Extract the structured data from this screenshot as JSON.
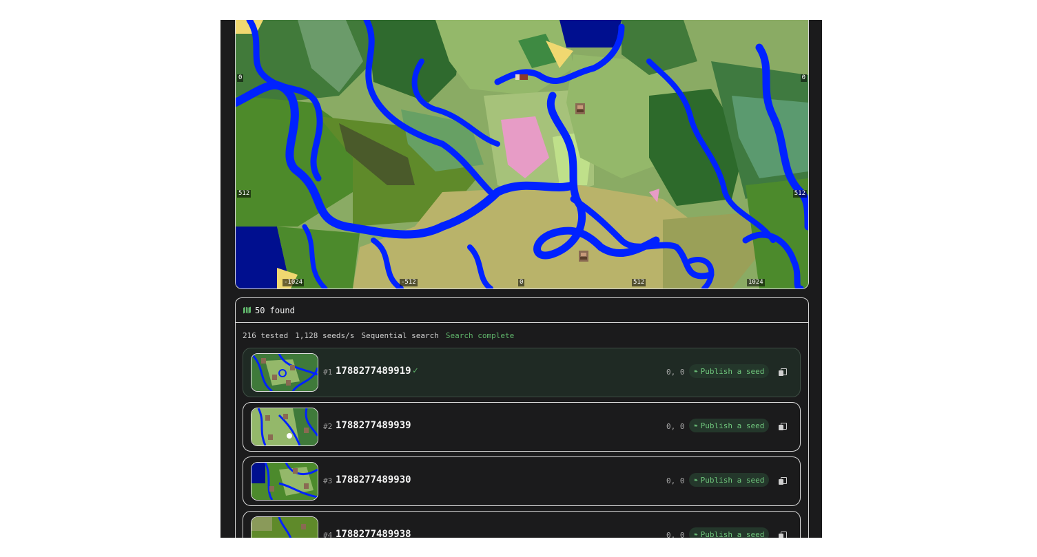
{
  "map": {
    "x_ticks": [
      "-1024",
      "-512",
      "0",
      "512",
      "1024"
    ],
    "y_ticks_left": [
      "0",
      "512"
    ],
    "y_ticks_right": [
      "0",
      "512"
    ]
  },
  "results": {
    "count_label": "50 found",
    "stats": {
      "tested": "216 tested",
      "speed": "1,128 seeds/s",
      "mode": "Sequential search",
      "status": "Search complete"
    },
    "items": [
      {
        "rank": "#1",
        "seed": "1788277489919",
        "checked": "✓",
        "coords": "0, 0",
        "publish_label": "Publish a seed"
      },
      {
        "rank": "#2",
        "seed": "1788277489939",
        "coords": "0, 0",
        "publish_label": "Publish a seed"
      },
      {
        "rank": "#3",
        "seed": "1788277489930",
        "coords": "0, 0",
        "publish_label": "Publish a seed"
      },
      {
        "rank": "#4",
        "seed": "1788277489938",
        "coords": "0, 0",
        "publish_label": "Publish a seed"
      }
    ]
  },
  "colors": {
    "panel_bg": "#1b1b1c",
    "accent_green": "#5fb36a",
    "river_blue": "#0022ff",
    "highlight_card_bg": "#1f2a24"
  },
  "icons": {
    "results_header": "map-icon",
    "publish": "sprout-icon",
    "copy": "copy-icon",
    "map_markers": "village-icon"
  }
}
